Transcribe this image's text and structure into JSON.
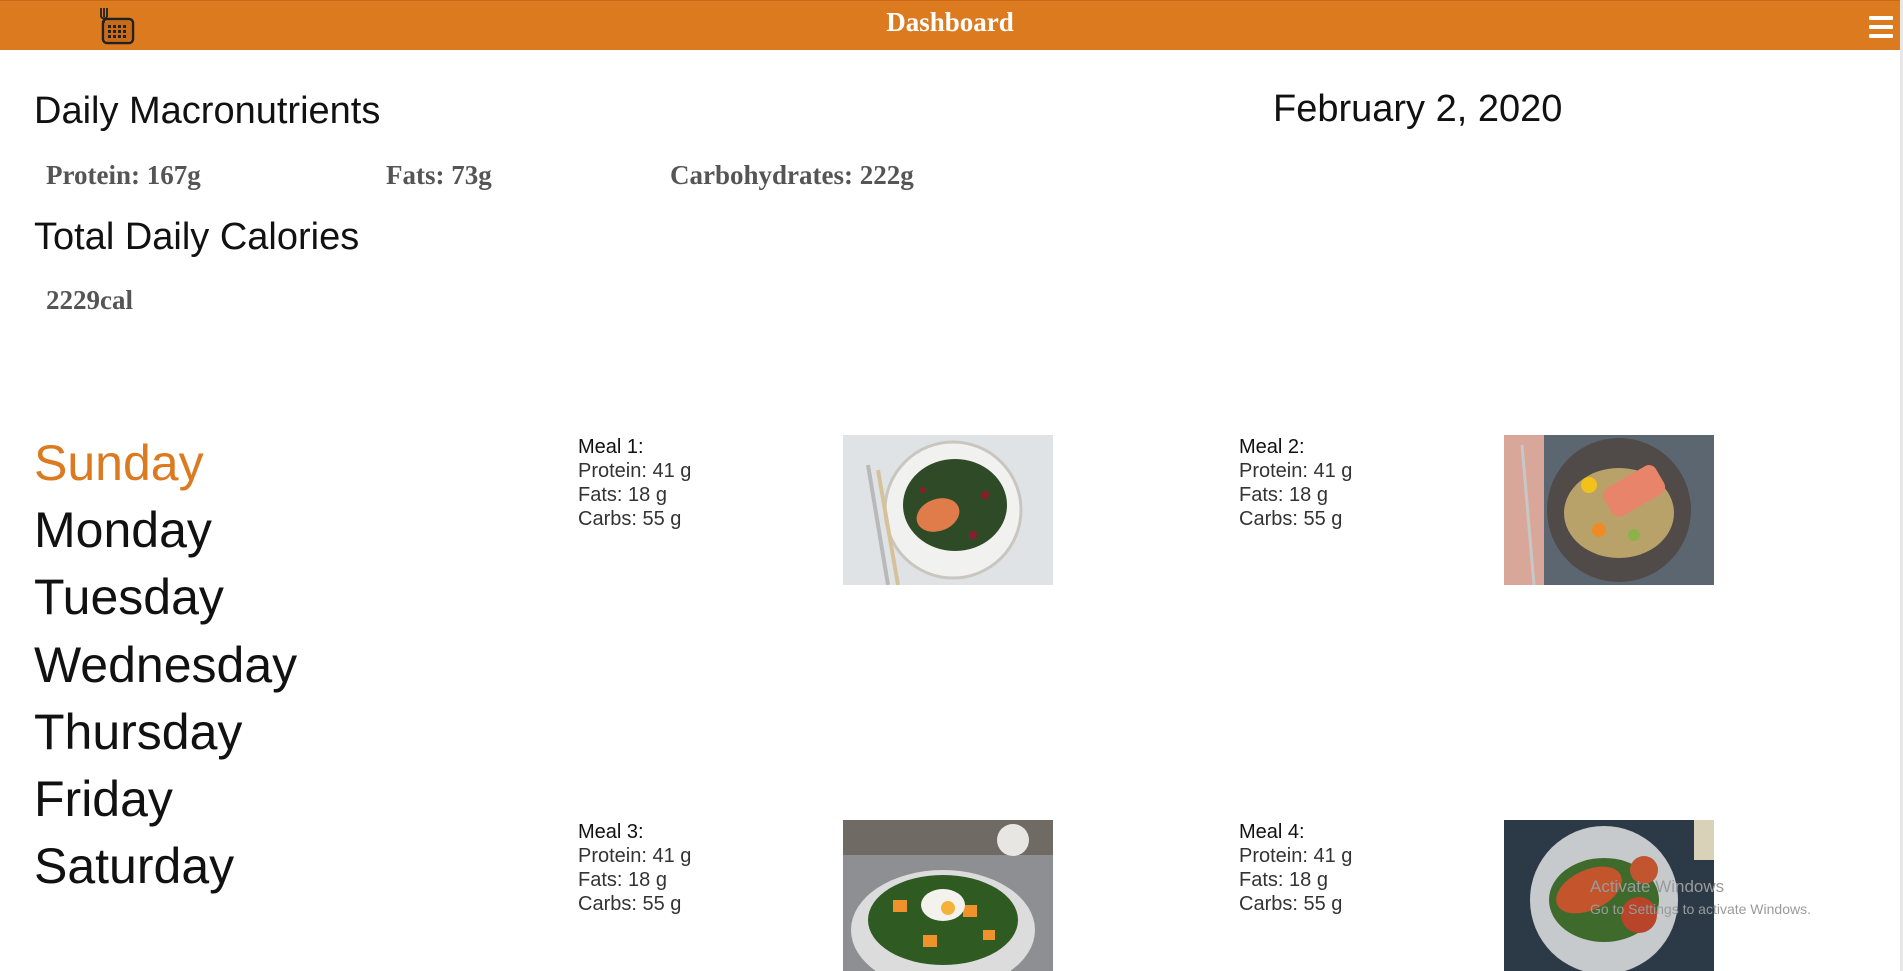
{
  "header": {
    "title": "Dashboard",
    "app_icon": "calendar-fork-icon",
    "menu_icon": "hamburger-menu-icon",
    "accent_color": "#dc7a20"
  },
  "macros": {
    "heading": "Daily Macronutrients",
    "protein": "Protein: 167g",
    "fats": "Fats: 73g",
    "carbs": "Carbohydrates: 222g"
  },
  "calories": {
    "heading": "Total Daily Calories",
    "value": "2229cal"
  },
  "date": "February 2, 2020",
  "days": [
    "Sunday",
    "Monday",
    "Tuesday",
    "Wednesday",
    "Thursday",
    "Friday",
    "Saturday"
  ],
  "selected_day": "Sunday",
  "meals": [
    {
      "title": "Meal 1:",
      "protein": "Protein: 41 g",
      "fats": "Fats: 18 g",
      "carbs": "Carbs: 55 g",
      "image": "salmon-kale-salad-photo"
    },
    {
      "title": "Meal 2:",
      "protein": "Protein: 41 g",
      "fats": "Fats: 18 g",
      "carbs": "Carbs: 55 g",
      "image": "salmon-quinoa-citrus-photo"
    },
    {
      "title": "Meal 3:",
      "protein": "Protein: 41 g",
      "fats": "Fats: 18 g",
      "carbs": "Carbs: 55 g",
      "image": "squash-kale-egg-bowl-photo"
    },
    {
      "title": "Meal 4:",
      "protein": "Protein: 41 g",
      "fats": "Fats: 18 g",
      "carbs": "Carbs: 55 g",
      "image": "chicken-green-beans-photo"
    }
  ],
  "watermark": {
    "line1": "Activate Windows",
    "line2": "Go to Settings to activate Windows."
  }
}
